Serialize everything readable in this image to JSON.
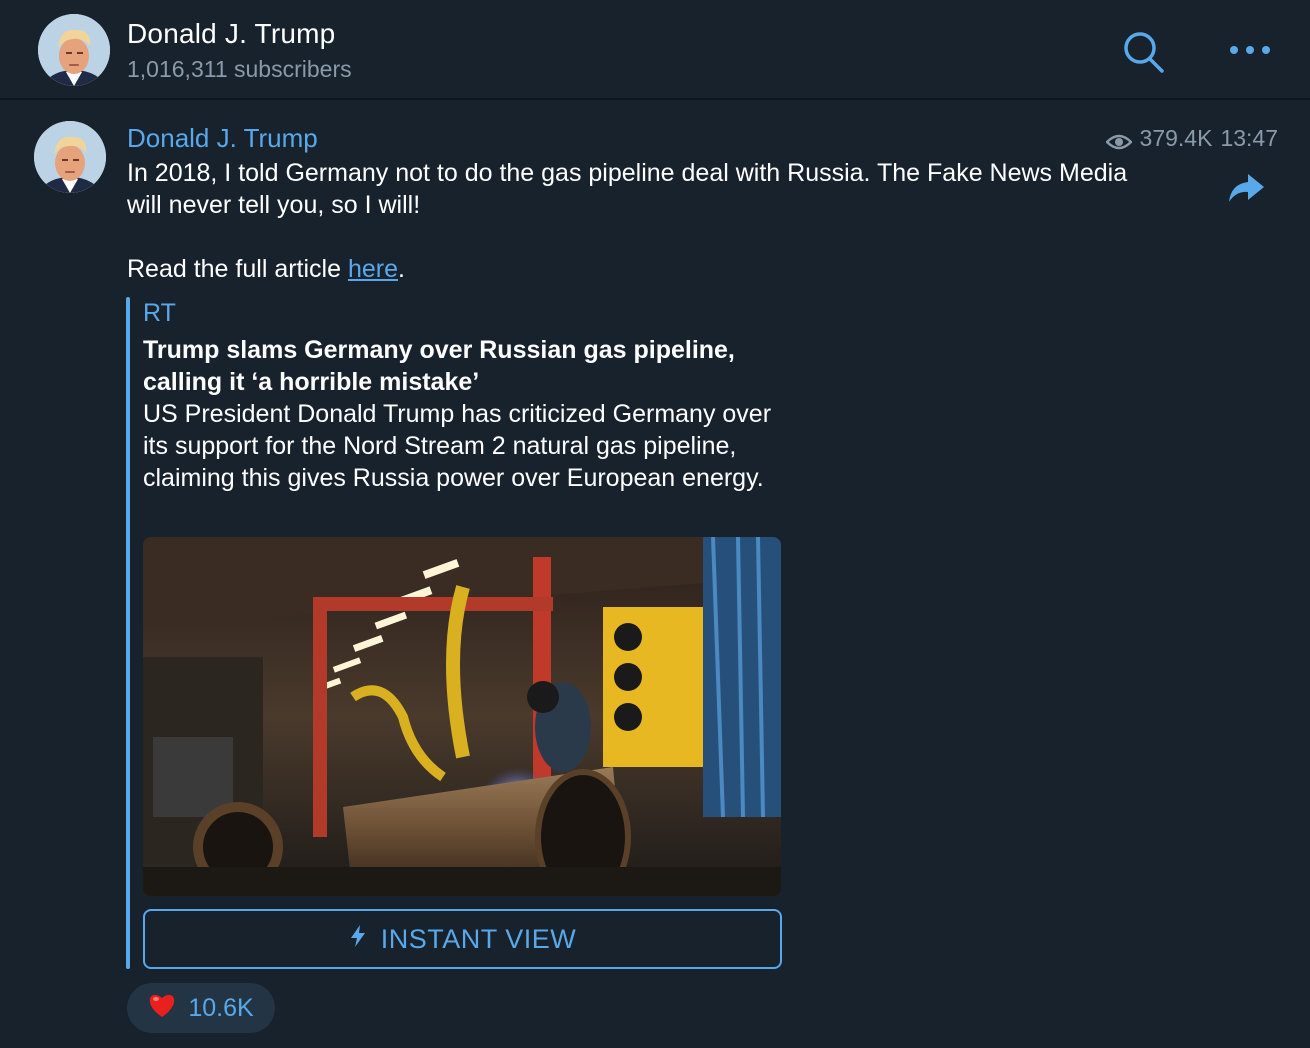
{
  "header": {
    "channel_name": "Donald J. Trump",
    "subscribers": "1,016,311 subscribers",
    "search_icon": "search-icon",
    "more_icon": "more-dots-icon"
  },
  "post": {
    "author": "Donald J. Trump",
    "views": "379.4K",
    "time": "13:47",
    "text": "In 2018, I told Germany not to do the gas pipeline deal with Russia. The Fake News Media will never tell you, so I will!",
    "read_prefix": "Read the full article ",
    "link_text": "here",
    "read_suffix": "."
  },
  "link_preview": {
    "site_name": "RT",
    "title": "Trump slams Germany over Russian gas pipeline, calling it ‘a horrible mistake’",
    "description": "US President Donald Trump has criticized Germany over its support for the Nord Stream 2 natural gas pipeline, claiming this gives Russia power over European energy.",
    "instant_view_label": "INSTANT VIEW"
  },
  "reaction": {
    "emoji": "heart",
    "count": "10.6K"
  },
  "colors": {
    "background": "#18222d",
    "accent": "#58a8ea",
    "muted": "#8b9aa9",
    "reaction_bg": "#233445"
  }
}
